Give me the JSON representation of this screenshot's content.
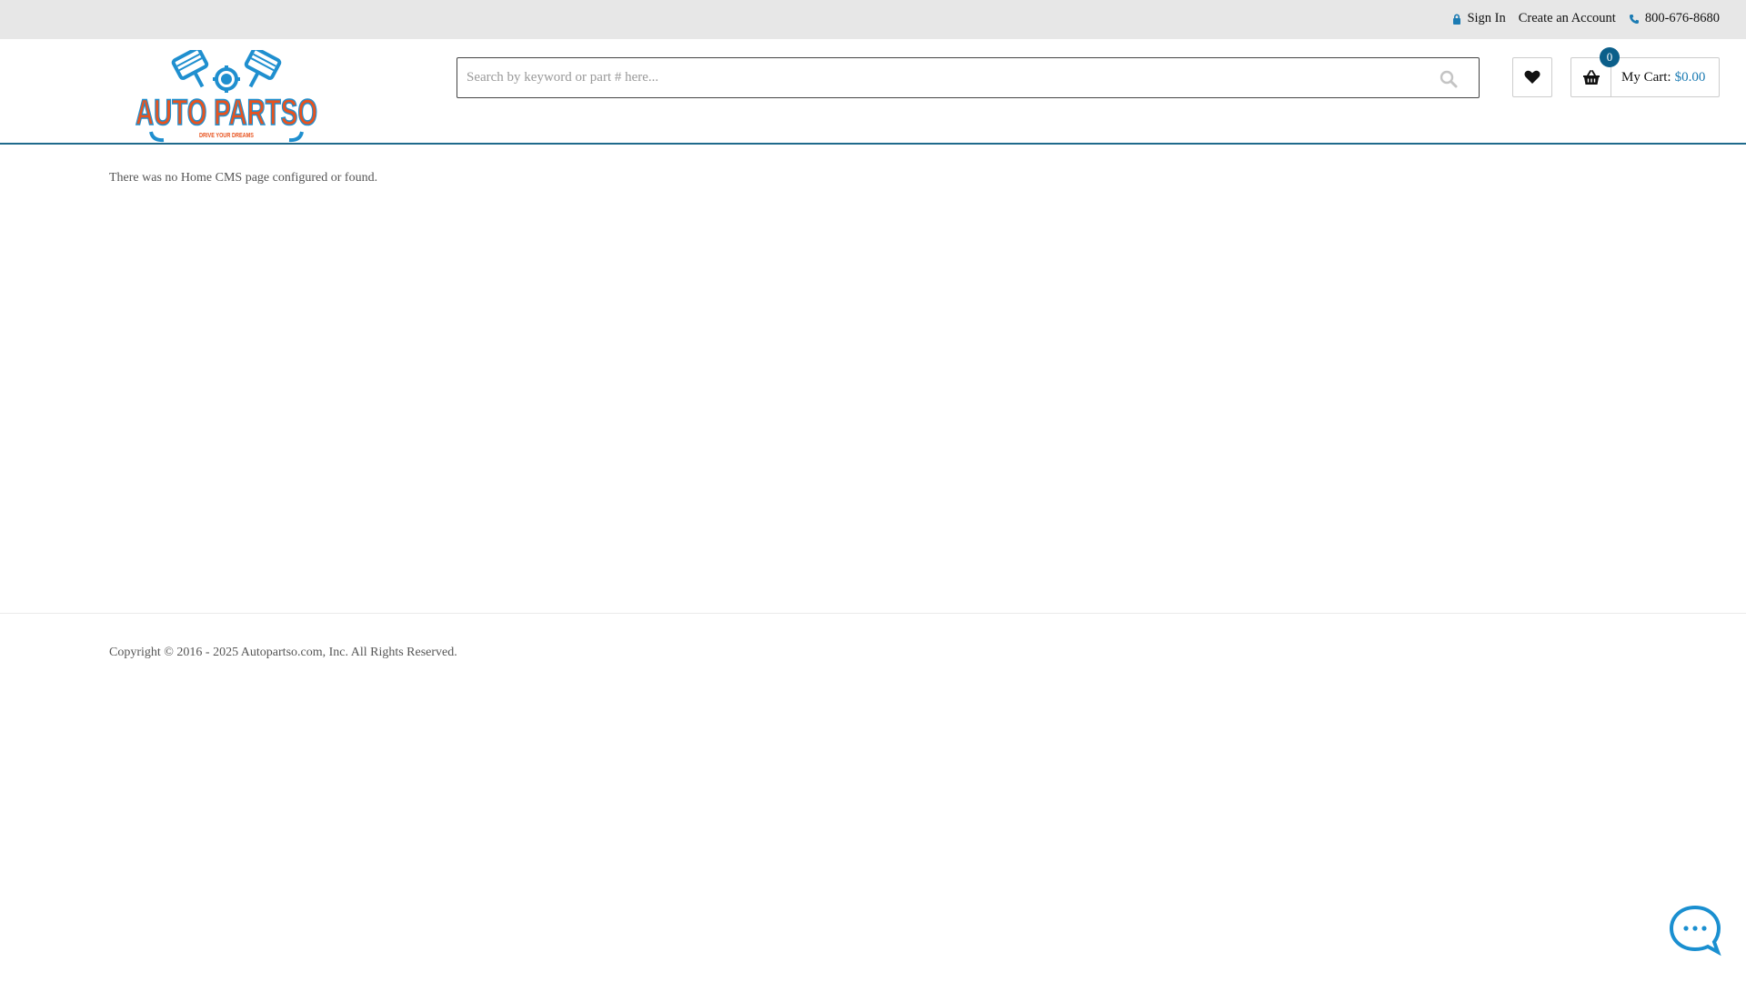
{
  "topbar": {
    "sign_in": "Sign In",
    "create_account": "Create an Account",
    "phone": "800-676-8680"
  },
  "logo": {
    "brand": "AUTO PARTSO",
    "tagline": "DRIVE YOUR DREAMS"
  },
  "search": {
    "placeholder": "Search by keyword or part # here...",
    "value": ""
  },
  "cart": {
    "count": "0",
    "label": "My Cart:",
    "total": "$0.00"
  },
  "main": {
    "message": "There was no Home CMS page configured or found."
  },
  "footer": {
    "copyright": "Copyright © 2016 - 2025  Autopartso.com, Inc. All Rights Reserved."
  },
  "icons": {
    "sign_in": "lock-icon",
    "phone": "phone-icon",
    "search": "search-icon",
    "wishlist": "heart-icon",
    "cart": "basket-icon",
    "chat": "chat-bubble-icon"
  },
  "colors": {
    "accent_blue": "#1b7bb3",
    "badge_blue": "#0b5f8a",
    "logo_orange": "#e8531f",
    "logo_blue": "#1f8fcf",
    "chat_blue": "#1a8fd0",
    "topbar_bg": "#e7e7e7",
    "header_rule": "#1f6a8c"
  }
}
